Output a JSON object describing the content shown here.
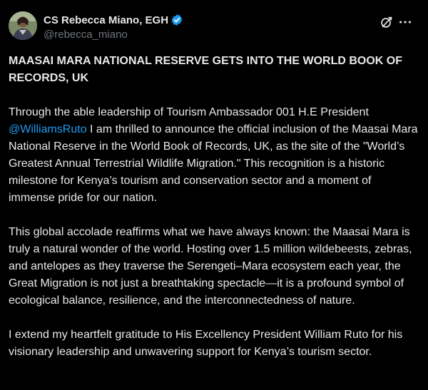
{
  "author": {
    "display_name": "CS Rebecca Miano, EGH",
    "handle": "@rebecca_miano",
    "verified_color": "#1d9bf0"
  },
  "icons": {
    "avatar": "profile-photo",
    "verified": "verified-badge-icon",
    "grok": "grok-icon",
    "more": "more-options-icon"
  },
  "post": {
    "headline": "MAASAI MARA NATIONAL RESERVE GETS INTO THE WORLD BOOK OF RECORDS, UK",
    "p1_before": "Through the able leadership of Tourism Ambassador 001 H.E President ",
    "p1_mention": "@WilliamsRuto",
    "p1_after": " I am thrilled to announce the official inclusion of the Maasai Mara National Reserve in the World Book of Records, UK, as the site of the \"World’s Greatest Annual Terrestrial Wildlife Migration.\" This recognition is a historic milestone for Kenya’s tourism and conservation sector and a moment of immense pride for our nation.",
    "p2": "This global accolade reaffirms what we have always known: the Maasai Mara is truly a natural wonder of the world. Hosting over 1.5 million wildebeests, zebras, and antelopes as they traverse the Serengeti–Mara ecosystem each year, the Great Migration is not just a breathtaking spectacle—it is a profound symbol of ecological balance, resilience, and the interconnectedness of nature.",
    "p3": "I extend my heartfelt gratitude to His Excellency President William Ruto for his visionary leadership and unwavering support for Kenya’s tourism sector."
  }
}
